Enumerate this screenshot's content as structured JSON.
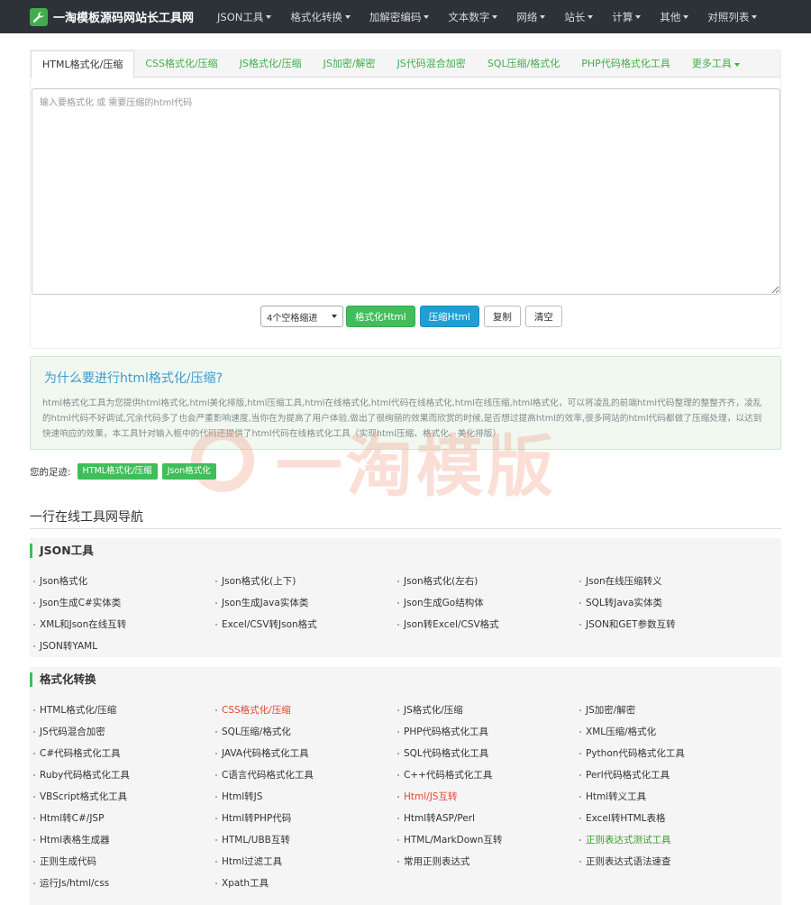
{
  "navbar": {
    "brand": "一淘模板源码网站长工具网",
    "menu": [
      {
        "label": "JSON工具",
        "dropdown": true
      },
      {
        "label": "格式化转换",
        "dropdown": true
      },
      {
        "label": "加解密编码",
        "dropdown": true
      },
      {
        "label": "文本数字",
        "dropdown": true
      },
      {
        "label": "网络",
        "dropdown": true
      },
      {
        "label": "站长",
        "dropdown": true
      },
      {
        "label": "计算",
        "dropdown": true
      },
      {
        "label": "其他",
        "dropdown": true
      },
      {
        "label": "对照列表",
        "dropdown": true
      }
    ]
  },
  "tabs": [
    {
      "label": "HTML格式化/压缩",
      "active": true
    },
    {
      "label": "CSS格式化/压缩"
    },
    {
      "label": "JS格式化/压缩"
    },
    {
      "label": "JS加密/解密"
    },
    {
      "label": "JS代码混合加密"
    },
    {
      "label": "SQL压缩/格式化"
    },
    {
      "label": "PHP代码格式化工具"
    },
    {
      "label": "更多工具",
      "dropdown": true
    }
  ],
  "editor": {
    "placeholder": "输入要格式化 或 需要压缩的html代码",
    "value": ""
  },
  "toolbar": {
    "indent_select": "4个空格缩进",
    "format_button": "格式化Html",
    "compress_button": "压缩Html",
    "copy_button": "复制",
    "clear_button": "清空"
  },
  "info": {
    "title": "为什么要进行html格式化/压缩?",
    "text": "html格式化工具为您提供html格式化,html美化排版,html压缩工具,html在线格式化,html代码在线格式化,html在线压缩,html格式化，可以将凌乱的前端html代码整理的整整齐齐，凌乱的html代码不好调试,冗余代码多了也会严重影响速度,当你在为提高了用户体验,做出了很绚丽的效果而欣赏的时候,是否想过提高html的效率,很多网站的html代码都做了压缩处理，以达到快速响应的效果，本工具针对输入框中的代码还提供了html代码在线格式化工具（实现html压缩、格式化、美化排版）"
  },
  "footprint": {
    "label": "您的足迹:",
    "tags": [
      "HTML格式化/压缩",
      "Json格式化"
    ]
  },
  "watermark": {
    "text": "一淘模版"
  },
  "nav_heading": "一行在线工具网导航",
  "sections": [
    {
      "title": "JSON工具",
      "links": [
        {
          "label": "Json格式化"
        },
        {
          "label": " Json格式化(上下)"
        },
        {
          "label": "Json格式化(左右)"
        },
        {
          "label": "Json在线压缩转义"
        },
        {
          "label": "Json生成C#实体类"
        },
        {
          "label": " Json生成Java实体类"
        },
        {
          "label": "Json生成Go结构体"
        },
        {
          "label": "SQL转Java实体类"
        },
        {
          "label": "XML和Json在线互转"
        },
        {
          "label": "Excel/CSV转Json格式"
        },
        {
          "label": "Json转Excel/CSV格式"
        },
        {
          "label": "JSON和GET参数互转"
        },
        {
          "label": "JSON转YAML"
        }
      ]
    },
    {
      "title": "格式化转换",
      "links": [
        {
          "label": "HTML格式化/压缩"
        },
        {
          "label": " CSS格式化/压缩",
          "color": "red"
        },
        {
          "label": "JS格式化/压缩"
        },
        {
          "label": "JS加密/解密"
        },
        {
          "label": " JS代码混合加密"
        },
        {
          "label": "SQL压缩/格式化"
        },
        {
          "label": "PHP代码格式化工具"
        },
        {
          "label": "XML压缩/格式化"
        },
        {
          "label": "C#代码格式化工具"
        },
        {
          "label": "JAVA代码格式化工具"
        },
        {
          "label": "SQL代码格式化工具"
        },
        {
          "label": "Python代码格式化工具"
        },
        {
          "label": "Ruby代码格式化工具"
        },
        {
          "label": "C语言代码格式化工具"
        },
        {
          "label": "C++代码格式化工具"
        },
        {
          "label": "Perl代码格式化工具"
        },
        {
          "label": "VBScript格式化工具"
        },
        {
          "label": " Html转JS"
        },
        {
          "label": "Html/JS互转",
          "color": "red"
        },
        {
          "label": " Html转义工具"
        },
        {
          "label": " Html转C#/JSP"
        },
        {
          "label": "Html转PHP代码"
        },
        {
          "label": "Html转ASP/Perl"
        },
        {
          "label": "Excel转HTML表格"
        },
        {
          "label": "Html表格生成器"
        },
        {
          "label": "HTML/UBB互转"
        },
        {
          "label": "HTML/MarkDown互转"
        },
        {
          "label": "正则表达式测试工具",
          "color": "green"
        },
        {
          "label": "正则生成代码"
        },
        {
          "label": "Html过滤工具"
        },
        {
          "label": "常用正则表达式"
        },
        {
          "label": "正则表达式语法速查"
        },
        {
          "label": "运行Js/html/css"
        },
        {
          "label": "Xpath工具"
        }
      ]
    }
  ]
}
